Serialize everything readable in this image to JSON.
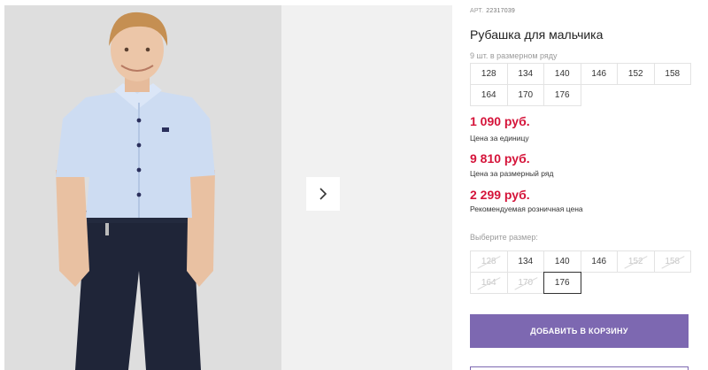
{
  "product": {
    "article_label": "АРТ.",
    "article_number": "22317039",
    "title": "Рубашка для мальчика"
  },
  "gallery": {
    "next_icon": "chevron-right-icon"
  },
  "series": {
    "note": "9 шт. в размерном ряду",
    "sizes": [
      "128",
      "134",
      "140",
      "146",
      "152",
      "158",
      "164",
      "170",
      "176"
    ]
  },
  "prices": {
    "unit_price": "1 090 руб.",
    "unit_label": "Цена за единицу",
    "series_price": "9 810 руб.",
    "series_label": "Цена за размерный ряд",
    "retail_price": "2 299 руб.",
    "retail_label": "Рекомендуемая розничная цена"
  },
  "size_picker": {
    "label": "Выберите размер:",
    "sizes": [
      {
        "label": "128",
        "available": false
      },
      {
        "label": "134",
        "available": true
      },
      {
        "label": "140",
        "available": true
      },
      {
        "label": "146",
        "available": true
      },
      {
        "label": "152",
        "available": false
      },
      {
        "label": "158",
        "available": false
      },
      {
        "label": "164",
        "available": false
      },
      {
        "label": "170",
        "available": false
      },
      {
        "label": "176",
        "available": true,
        "selected": true
      }
    ]
  },
  "actions": {
    "add_to_cart": "ДОБАВИТЬ В КОРЗИНУ"
  },
  "colors": {
    "price": "#d5143a",
    "accent": "#7d68b1",
    "shirt": "#c9d9f0",
    "trousers": "#1e2437"
  }
}
